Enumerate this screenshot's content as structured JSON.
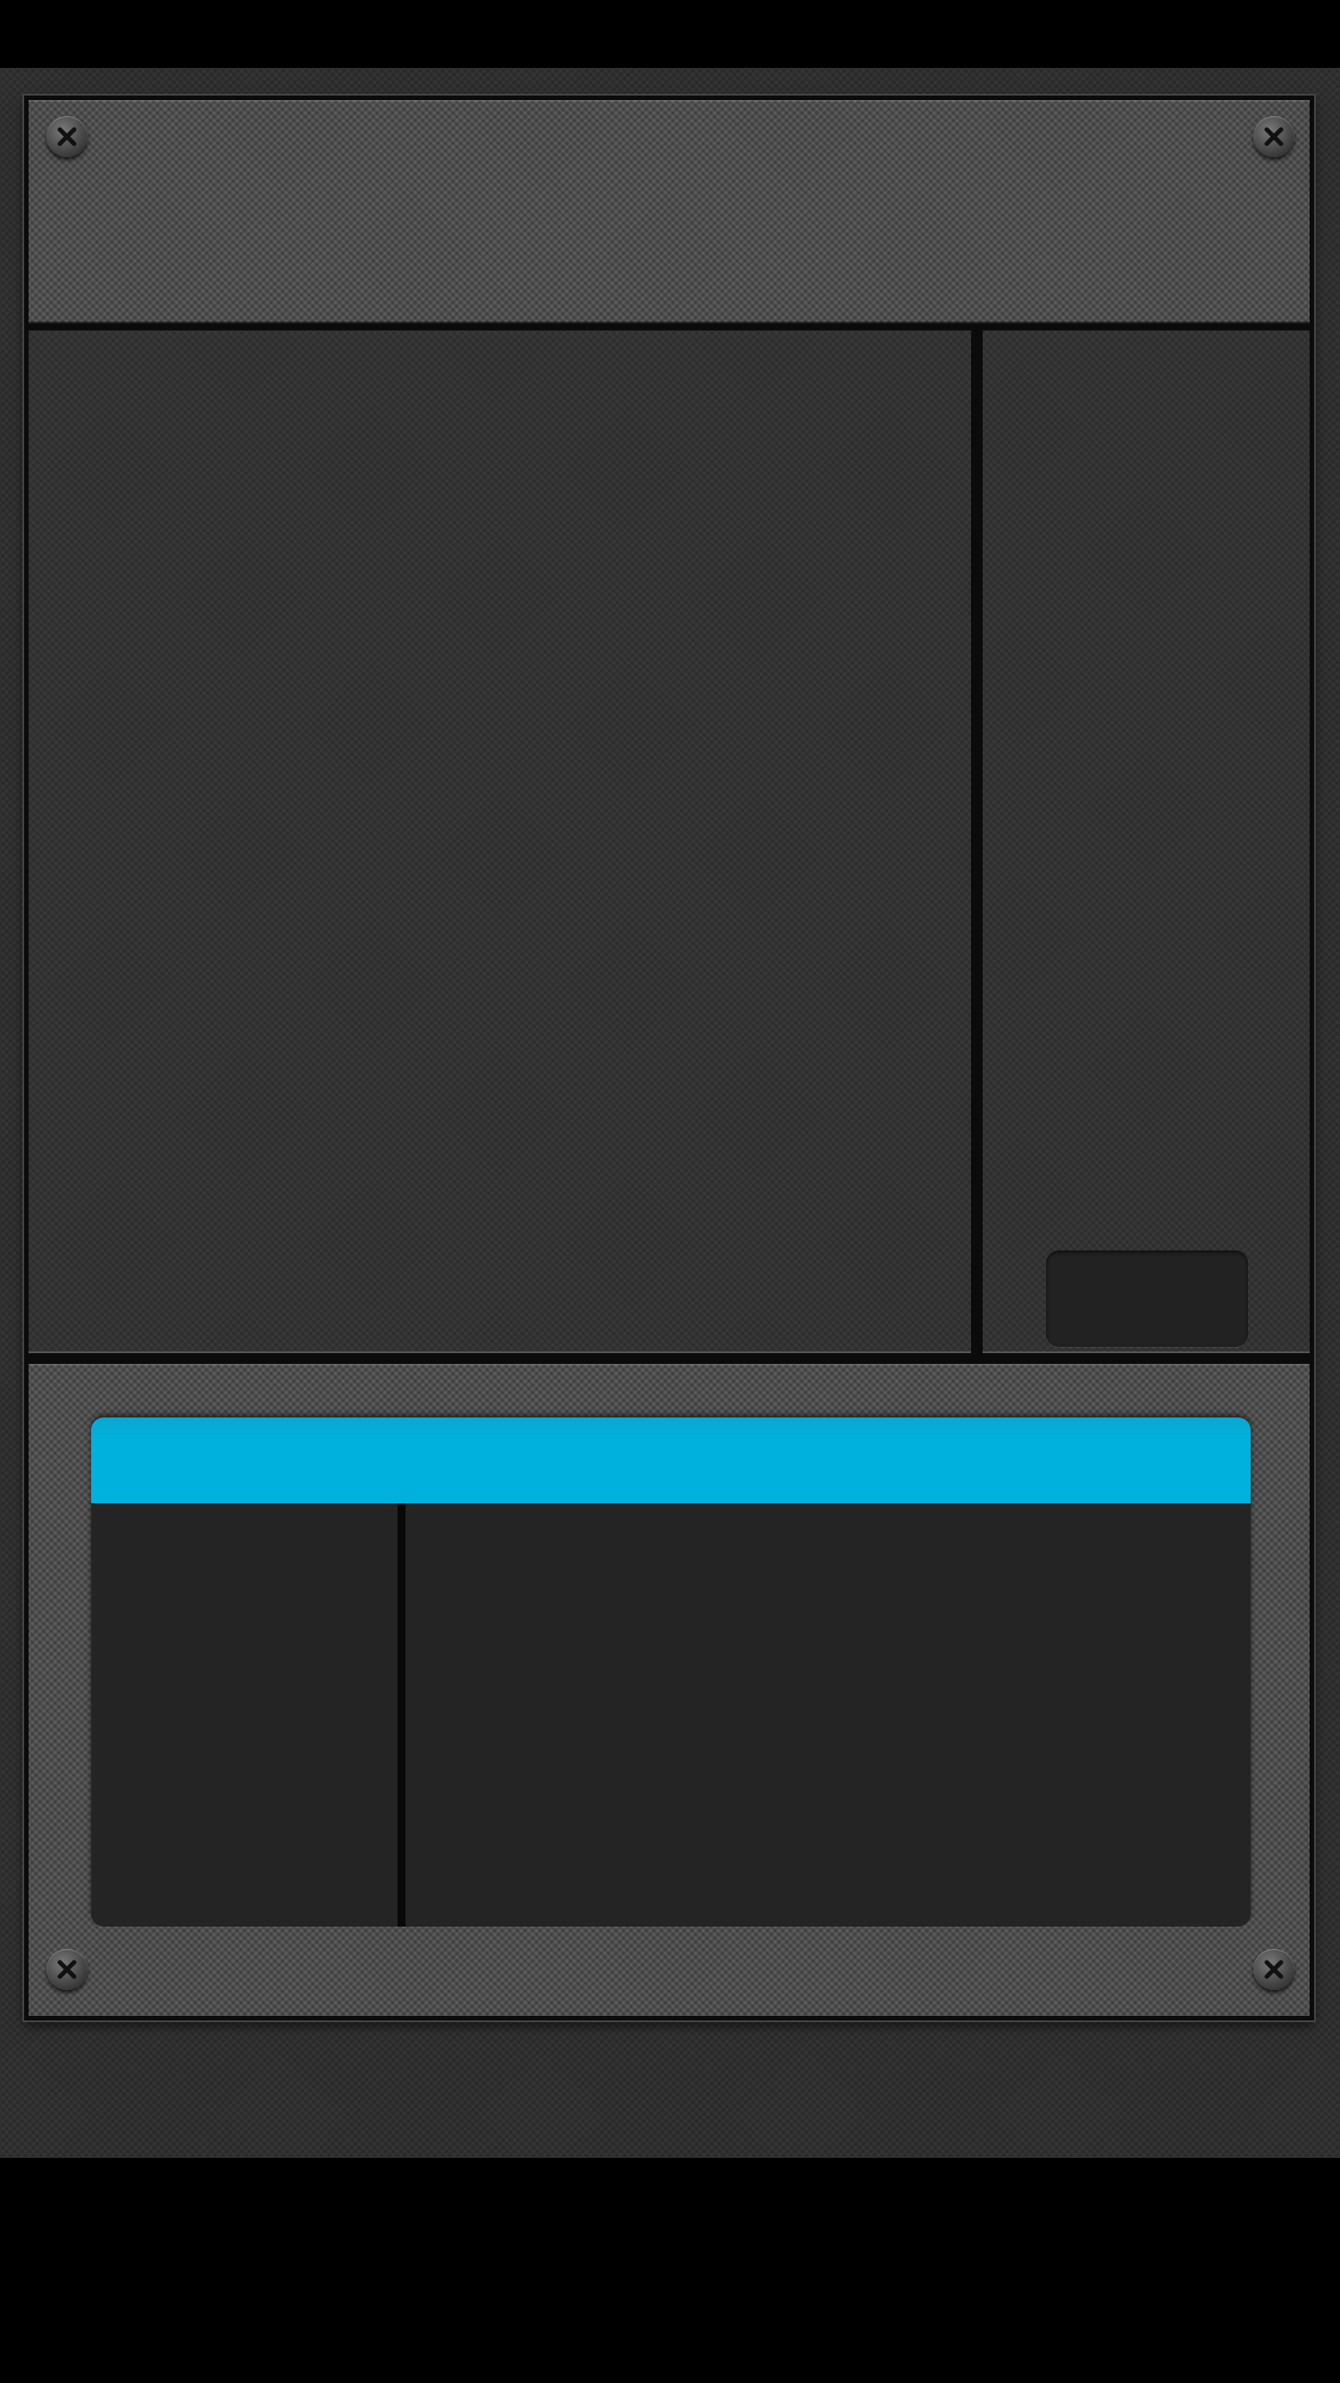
{
  "app": {
    "title": ""
  },
  "top_panel": {
    "label": ""
  },
  "main_area": {
    "content": ""
  },
  "side_panel": {
    "button_label": ""
  },
  "card": {
    "header_label": "",
    "left_content": "",
    "right_content": ""
  },
  "theme": {
    "accent": "#00b1dd",
    "frame": "#0b0b0b",
    "panel_light": "#4a4a4a",
    "panel_dark": "#313131",
    "button": "#222222"
  },
  "icons": [
    "screw-icon"
  ]
}
